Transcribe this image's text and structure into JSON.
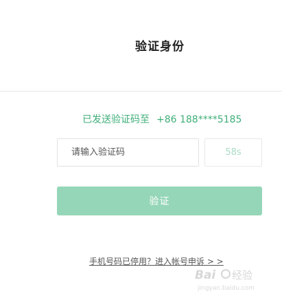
{
  "header": {
    "title": "验证身份"
  },
  "verification": {
    "sent_prefix": "已发送验证码至",
    "phone": "+86 188****5185",
    "code_placeholder": "请输入验证码",
    "countdown": "58s",
    "verify_label": "验证"
  },
  "footer": {
    "appeal_link": "手机号码已停用？进入帐号申诉 > >"
  },
  "watermark": {
    "brand": "Baidu 经验",
    "url": "jingyan.baidu.com"
  },
  "colors": {
    "accent": "#3fae79",
    "button_bg": "#96d6b8",
    "countdown_text": "#a8dcc4"
  }
}
